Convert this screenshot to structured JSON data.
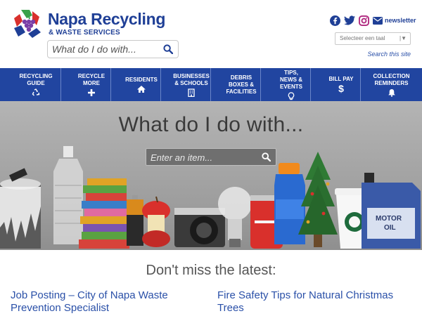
{
  "brand": {
    "title": "Napa Recycling",
    "subtitle": "& WASTE SERVICES",
    "colors": {
      "navy": "#1f3f96",
      "grape": "#6a3a96",
      "green": "#3aa14a",
      "red": "#d9302c"
    }
  },
  "header_search": {
    "placeholder": "What do I do with...",
    "icon": "search-icon"
  },
  "social": {
    "icons": [
      "facebook-icon",
      "twitter-icon",
      "instagram-icon",
      "envelope-icon"
    ],
    "newsletter_label": "newsletter"
  },
  "language": {
    "selected": "Selecteer een taal",
    "arrow": "|▼"
  },
  "search_site": "Search this site",
  "nav": {
    "items": [
      {
        "label": "RECYCLING\nGUIDE",
        "icon": "recycle-icon"
      },
      {
        "label": "RECYCLE\nMORE",
        "icon": "plus-icon"
      },
      {
        "label": "RESIDENTS",
        "icon": "home-icon"
      },
      {
        "label": "BUSINESSES\n& SCHOOLS",
        "icon": "building-icon"
      },
      {
        "label": "DEBRIS\nBOXES &\nFACILITIES",
        "icon": ""
      },
      {
        "label": "TIPS,\nNEWS &\nEVENTS",
        "icon": "lightbulb-icon"
      },
      {
        "label": "BILL PAY",
        "icon": "dollar-icon"
      },
      {
        "label": "COLLECTION\nREMINDERS",
        "icon": "bell-icon"
      }
    ],
    "color": "#2145a0"
  },
  "hero": {
    "title": "What do I do with...",
    "search_placeholder": "Enter an item...",
    "bottle_cap_text": "MOTOR\nOIL"
  },
  "latest": {
    "title": "Don't miss the latest:",
    "posts": [
      {
        "title": "Job Posting – City of Napa Waste Prevention Specialist"
      },
      {
        "title": "Fire Safety Tips for Natural Christmas Trees"
      }
    ]
  }
}
